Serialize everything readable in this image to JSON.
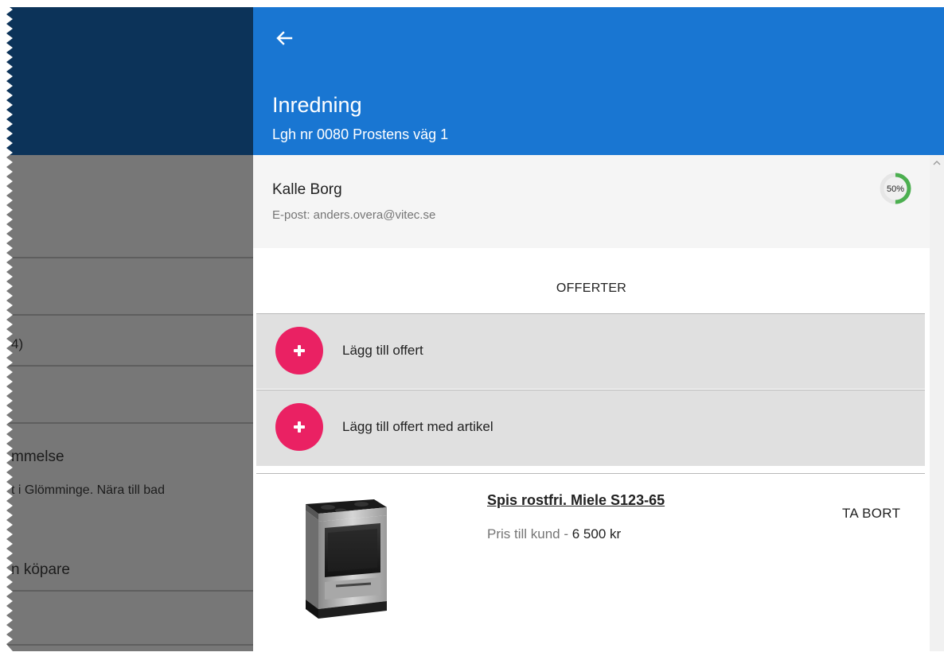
{
  "background_app": {
    "rows": [
      {
        "text": ""
      },
      {
        "text": ""
      },
      {
        "text": "4)"
      },
      {
        "text": ""
      },
      {
        "text": "mmelse"
      },
      {
        "text": "t i Glömminge. Nära till bad"
      },
      {
        "text": "n köpare"
      }
    ]
  },
  "header": {
    "back_icon": "arrow-left-icon",
    "title": "Inredning",
    "subtitle": "Lgh nr 0080 Prostens väg 1"
  },
  "customer": {
    "name": "Kalle Borg",
    "email": "E-post: anders.overa@vitec.se",
    "progress_label": "50%",
    "progress_value": 0.5
  },
  "offers": {
    "section_title": "OFFERTER",
    "actions": [
      {
        "label": "Lägg till offert",
        "icon": "plus-icon"
      },
      {
        "label": "Lägg till offert med artikel",
        "icon": "plus-icon"
      }
    ],
    "items": [
      {
        "name": "Spis rostfri. Miele S123-65",
        "price_label": "Pris till kund - ",
        "price_value": "6 500 kr",
        "remove_label": "TA BORT",
        "image": "stove-image"
      }
    ]
  },
  "colors": {
    "appbar": "#1976d2",
    "accent": "#ea2163",
    "progress": "#4caf50",
    "left_header": "#0c3359",
    "overlay": "#777777"
  }
}
